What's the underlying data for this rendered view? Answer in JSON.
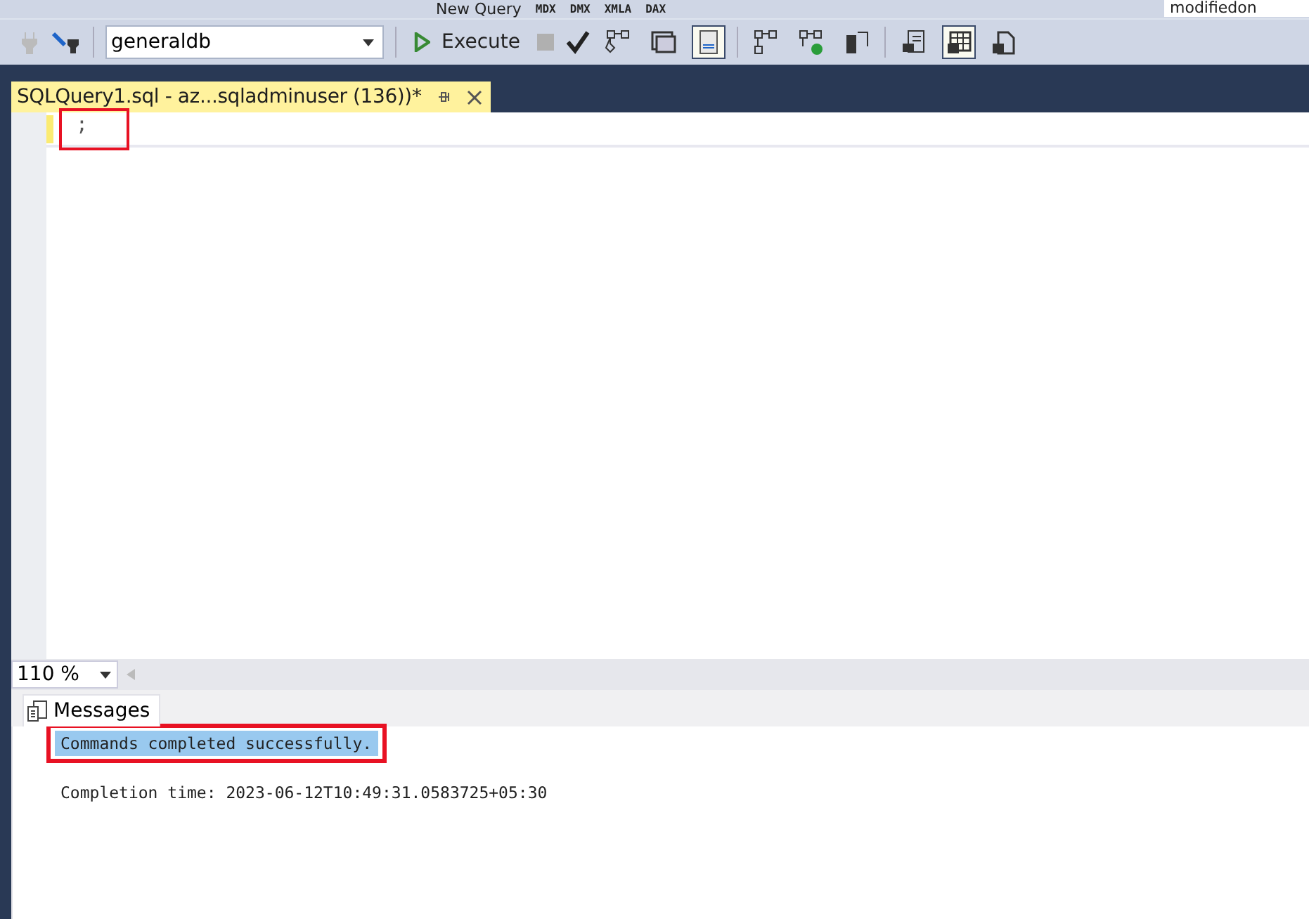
{
  "toolbar_top": {
    "new_query": "New Query",
    "badges": [
      "MDX",
      "DMX",
      "XMLA",
      "DAX"
    ],
    "search": {
      "value": "modifiedon"
    }
  },
  "toolbar": {
    "database": "generaldb",
    "execute": "Execute",
    "toggles": [
      {
        "selected": false
      },
      {
        "selected": false
      },
      {
        "selected": true
      },
      {
        "selected": false
      },
      {
        "selected": false
      },
      {
        "selected": false
      },
      {
        "selected": false
      },
      {
        "selected": true
      },
      {
        "selected": false
      }
    ]
  },
  "tab": {
    "title": "SQLQuery1.sql - az...sqladminuser (136))*",
    "selected": true
  },
  "editor": {
    "lines": [
      {
        "text": ";",
        "highlighted": true
      }
    ]
  },
  "zoom": "110 %",
  "results": {
    "tab": "Messages",
    "messages": [
      {
        "text": "Commands completed successfully.",
        "selected": true,
        "highlighted": true
      },
      {
        "text": "Completion time: 2023-06-12T10:49:31.0583725+05:30",
        "selected": false,
        "highlighted": false
      }
    ]
  }
}
